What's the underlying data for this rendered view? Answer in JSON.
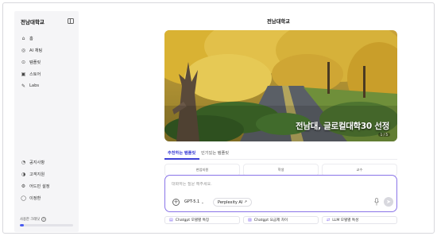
{
  "app": {
    "brand": "전남대학교",
    "page_title": "전남대학교"
  },
  "sidebar": {
    "items": [
      {
        "label": "홈",
        "icon": "home-icon"
      },
      {
        "label": "AI 채팅",
        "icon": "chat-icon"
      },
      {
        "label": "템플릿",
        "icon": "template-icon"
      },
      {
        "label": "스토어",
        "icon": "store-icon"
      },
      {
        "label": "Labs",
        "icon": "labs-icon"
      }
    ],
    "bottom_items": [
      {
        "label": "공지사항",
        "icon": "announcement-icon"
      },
      {
        "label": "고객지원",
        "icon": "support-icon"
      },
      {
        "label": "어드민 설정",
        "icon": "settings-icon"
      },
      {
        "label": "이정환",
        "icon": "user-icon"
      }
    ],
    "usage": {
      "label": "사용한 크레딧",
      "fraction": 0.08
    }
  },
  "hero": {
    "caption": "전남대, 글로컬대학30 선정",
    "sub": "1 / 5"
  },
  "tabs": [
    {
      "label": "추천하는 템플릿",
      "active": true
    },
    {
      "label": "인기있는 템플릿",
      "active": false
    }
  ],
  "cards": [
    "현업지원",
    "학생",
    "교수"
  ],
  "composer": {
    "placeholder": "대화하는 질문 해주세요.",
    "model": "GPT-5.1",
    "tool": "Perplexity AI"
  },
  "suggestions": [
    {
      "label": "Chatgpt 모델별 특징"
    },
    {
      "label": "Chatgpt 요금제 차이"
    },
    {
      "label": "LLM 모델별 특성"
    }
  ],
  "colors": {
    "accent": "#3e41d6",
    "composer_border": "#8a74e8",
    "sidebar_bg": "#f5f5f7"
  }
}
